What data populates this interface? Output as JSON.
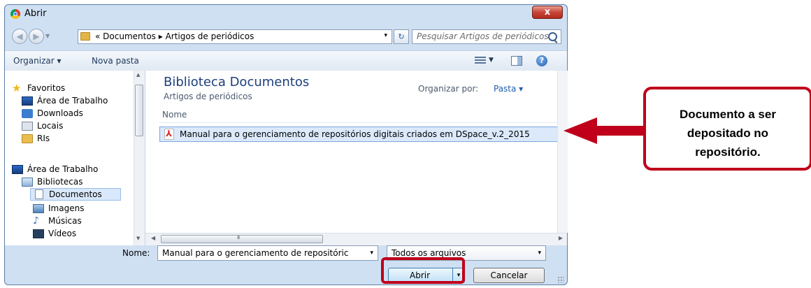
{
  "window": {
    "title": "Abrir",
    "close_symbol": "x"
  },
  "address": {
    "breadcrumb": "« Documentos ▸ Artigos de periódicos",
    "dropdown_symbol": "▾",
    "refresh_symbol": "↻"
  },
  "search": {
    "placeholder": "Pesquisar Artigos de periódicos"
  },
  "toolbar": {
    "organize": "Organizar ▾",
    "new_folder": "Nova pasta",
    "help_symbol": "?"
  },
  "nav": {
    "items": [
      {
        "label": "Favoritos",
        "icon": "star-icon"
      },
      {
        "label": "Área de Trabalho",
        "icon": "desktop-icon"
      },
      {
        "label": "Downloads",
        "icon": "downloads-icon"
      },
      {
        "label": "Locais",
        "icon": "locais-icon"
      },
      {
        "label": "RIs",
        "icon": "folder-icon"
      },
      {
        "label": "Área de Trabalho",
        "icon": "desktop-icon"
      },
      {
        "label": "Bibliotecas",
        "icon": "library-icon"
      },
      {
        "label": "Documentos",
        "icon": "document-icon",
        "selected": true
      },
      {
        "label": "Imagens",
        "icon": "images-icon"
      },
      {
        "label": "Músicas",
        "icon": "music-icon"
      },
      {
        "label": "Vídeos",
        "icon": "video-icon"
      }
    ]
  },
  "content": {
    "library_title": "Biblioteca Documentos",
    "library_subtitle": "Artigos de periódicos",
    "arrange_by_label": "Organizar por:",
    "arrange_by_value": "Pasta ▾",
    "column_name": "Nome",
    "files": [
      {
        "name": "Manual para o gerenciamento de repositórios digitais criados em DSpace_v.2_2015",
        "icon": "pdf-icon"
      }
    ]
  },
  "bottom": {
    "name_label": "Nome:",
    "name_value": "Manual para o gerenciamento de repositóric",
    "filetype_value": "Todos os arquivos",
    "open_label": "Abrir",
    "cancel_label": "Cancelar",
    "chevron": "▾"
  },
  "annotation": {
    "callout_lines": [
      "Documento a ser",
      "depositado no",
      "repositório."
    ],
    "color": "#c0001a"
  }
}
